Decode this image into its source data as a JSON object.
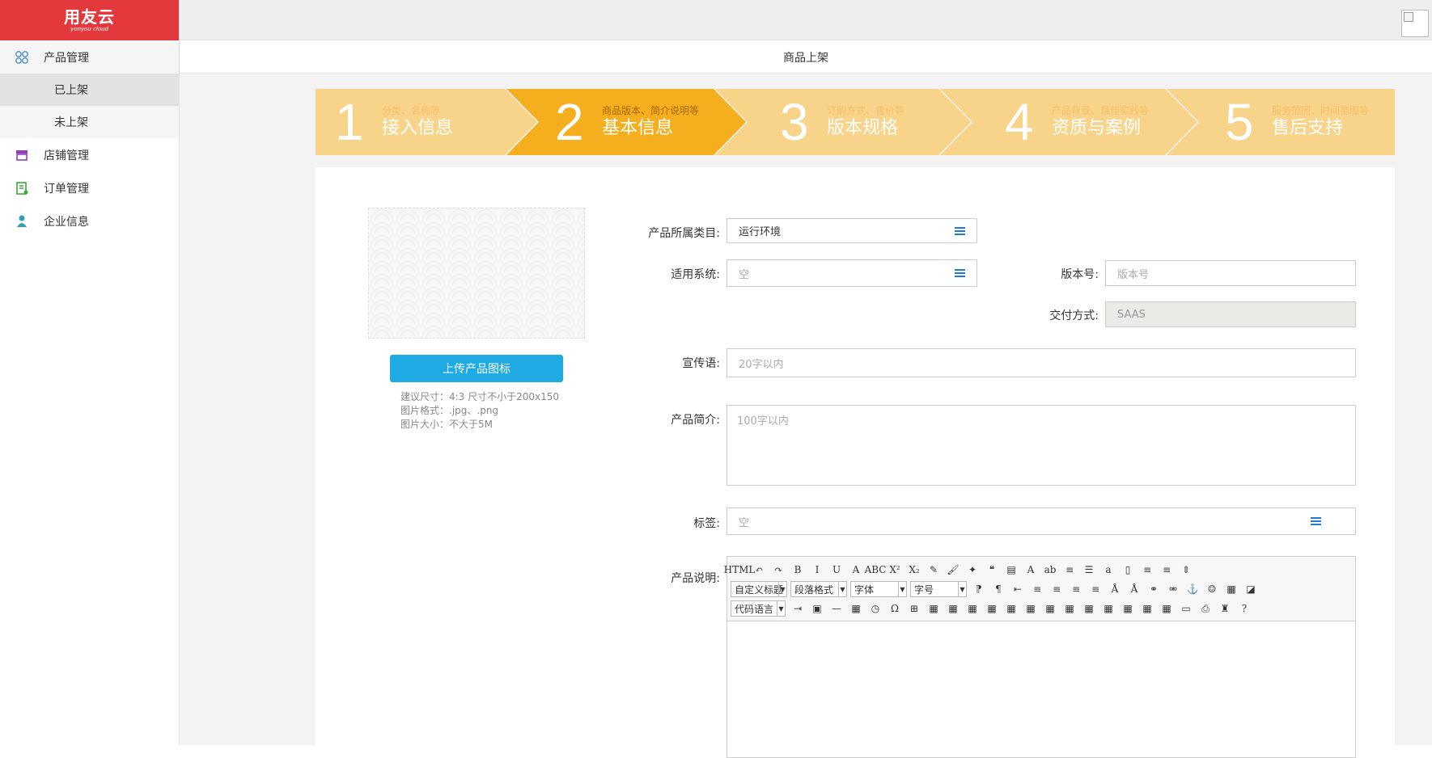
{
  "app": {
    "logo_text": "用友云",
    "logo_sub": "yonyou cloud"
  },
  "sidebar": {
    "items": [
      {
        "label": "产品管理",
        "icon": "product-icon"
      },
      {
        "label": "店铺管理",
        "icon": "store-icon"
      },
      {
        "label": "订单管理",
        "icon": "order-icon"
      },
      {
        "label": "企业信息",
        "icon": "company-icon"
      }
    ],
    "subitems": [
      {
        "label": "已上架",
        "active": true
      },
      {
        "label": "未上架",
        "active": false
      }
    ]
  },
  "header": {
    "title": "商品上架"
  },
  "steps": [
    {
      "num": "1",
      "hint": "分类、名称等",
      "title": "接入信息",
      "active": false
    },
    {
      "num": "2",
      "hint": "商品版本、简介说明等",
      "title": "基本信息",
      "active": true
    },
    {
      "num": "3",
      "hint": "订购方式、售价等",
      "title": "版本规格",
      "active": false
    },
    {
      "num": "4",
      "hint": "产品背景、最佳实践等",
      "title": "资质与案例",
      "active": false
    },
    {
      "num": "5",
      "hint": "服务范围、时间范围等",
      "title": "售后支持",
      "active": false
    }
  ],
  "colors": {
    "step_active": "#f5ae1d",
    "step_inactive": "#f8d38a",
    "upload_button": "#1eaae4",
    "brand_red": "#e4393c"
  },
  "upload": {
    "button_label": "上传产品图标",
    "tips": [
      "建议尺寸：4:3 尺寸不小于200x150",
      "图片格式：.jpg、.png",
      "图片大小：不大于5M"
    ]
  },
  "form": {
    "category_label": "产品所属类目:",
    "category_value": "运行环境",
    "system_label": "适用系统:",
    "system_value": "空",
    "version_label": "版本号:",
    "version_placeholder": "版本号",
    "delivery_label": "交付方式:",
    "delivery_value": "SAAS",
    "slogan_label": "宣传语:",
    "slogan_placeholder": "20字以内",
    "intro_label": "产品简介:",
    "intro_placeholder": "100字以内",
    "tags_label": "标签:",
    "tags_value": "空",
    "desc_label": "产品说明:"
  },
  "editor": {
    "row1": [
      "HTML",
      "↶",
      "↷",
      "B",
      "I",
      "U",
      "A",
      "ABC",
      "X²",
      "X₂",
      "✎",
      "🖌",
      "✦",
      "❝",
      "▤",
      "A",
      "ab",
      "≡",
      "☰",
      "a",
      "▯",
      "≡",
      "≡",
      "⇕"
    ],
    "row2_selects": [
      "自定义标题",
      "段落格式",
      "字体",
      "字号"
    ],
    "row2": [
      "⁋",
      "¶",
      "⇤",
      "≡",
      "≡",
      "≡",
      "≡",
      "Å",
      "Å",
      "⚭",
      "⚮",
      "⚓",
      "☺",
      "▦",
      "◪"
    ],
    "row3_select": "代码语言",
    "row3": [
      "⇥",
      "▣",
      "—",
      "▦",
      "◷",
      "Ω",
      "⊞",
      "▦",
      "▦",
      "▦",
      "▦",
      "▦",
      "▦",
      "▦",
      "▦",
      "▦",
      "▦",
      "▦",
      "▦",
      "▦",
      "▭",
      "⎙",
      "♜",
      "?"
    ]
  }
}
